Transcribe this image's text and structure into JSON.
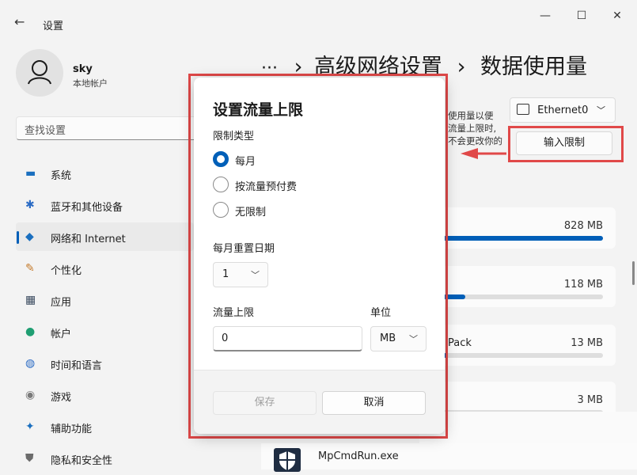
{
  "window": {
    "title": "设置",
    "controls": {
      "minimize": "—",
      "maximize": "☐",
      "close": "✕"
    }
  },
  "user": {
    "name": "sky",
    "account_type": "本地帐户"
  },
  "search": {
    "placeholder": "查找设置"
  },
  "sidebar": {
    "items": [
      {
        "label": "系统",
        "icon": "monitor-icon",
        "color": "#1a6fbf"
      },
      {
        "label": "蓝牙和其他设备",
        "icon": "bluetooth-icon",
        "color": "#2b6bc4"
      },
      {
        "label": "网络和 Internet",
        "icon": "wifi-icon",
        "color": "#1a6fbf",
        "selected": true
      },
      {
        "label": "个性化",
        "icon": "brush-icon",
        "color": "#c47a2b"
      },
      {
        "label": "应用",
        "icon": "apps-icon",
        "color": "#3a4a5f"
      },
      {
        "label": "帐户",
        "icon": "person-icon",
        "color": "#1f9e72"
      },
      {
        "label": "时间和语言",
        "icon": "globe-clock-icon",
        "color": "#2b6bc4"
      },
      {
        "label": "游戏",
        "icon": "gamepad-icon",
        "color": "#7a7a7a"
      },
      {
        "label": "辅助功能",
        "icon": "accessibility-icon",
        "color": "#1a6fbf"
      },
      {
        "label": "隐私和安全性",
        "icon": "shield-icon",
        "color": "#6b6b6b"
      }
    ]
  },
  "header": {
    "ellipsis": "···",
    "separator": "›",
    "crumb_parent": "高级网络设置",
    "crumb_current": "数据使用量"
  },
  "adapter_select": {
    "value": "Ethernet0"
  },
  "description_lines": [
    "使用量以便",
    "流量上限时,",
    "不会更改你的"
  ],
  "limit_button": {
    "label": "输入限制"
  },
  "usage": [
    {
      "label": "",
      "value": "828 MB",
      "fraction": 1.0
    },
    {
      "label": "",
      "value": "118 MB",
      "fraction": 0.14
    },
    {
      "label": "Pack",
      "value": "13 MB",
      "fraction": 0.02
    },
    {
      "label": "",
      "value": "3 MB",
      "fraction": 0.0
    }
  ],
  "app_row": {
    "label": "MpCmdRun.exe"
  },
  "dialog": {
    "title": "设置流量上限",
    "limit_type_label": "限制类型",
    "options": [
      {
        "label": "每月",
        "checked": true
      },
      {
        "label": "按流量预付费",
        "checked": false
      },
      {
        "label": "无限制",
        "checked": false
      }
    ],
    "reset_day_label": "每月重置日期",
    "reset_day_value": "1",
    "limit_label": "流量上限",
    "limit_value": "0",
    "unit_label": "单位",
    "unit_value": "MB",
    "save_label": "保存",
    "cancel_label": "取消"
  },
  "colors": {
    "accent": "#005fb8",
    "annotation": "#e04848"
  }
}
